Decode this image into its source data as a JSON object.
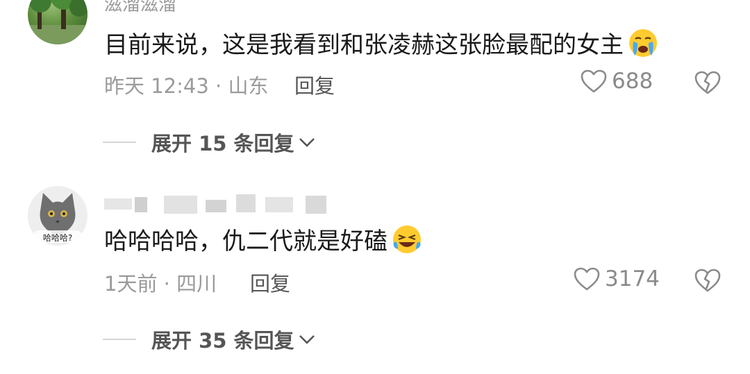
{
  "comments": [
    {
      "username": "滋溜滋溜",
      "text": "目前来说，这是我看到和张凌赫这张脸最配的女主",
      "emoji": "crying-face-emoji",
      "meta": "昨天 12:43 · 山东",
      "reply_label": "回复",
      "likes": "688",
      "expand_label": "展开 15 条回复"
    },
    {
      "username": "",
      "avatar_text": "哈哈哈?",
      "text": "哈哈哈哈，仇二代就是好磕",
      "emoji": "laughing-face-emoji",
      "meta": "1天前 · 四川",
      "reply_label": "回复",
      "likes": "3174",
      "expand_label": "展开 35 条回复"
    }
  ],
  "colors": {
    "muted": "#9a9a9a",
    "text": "#1a1a1a",
    "accent": "#555555"
  }
}
